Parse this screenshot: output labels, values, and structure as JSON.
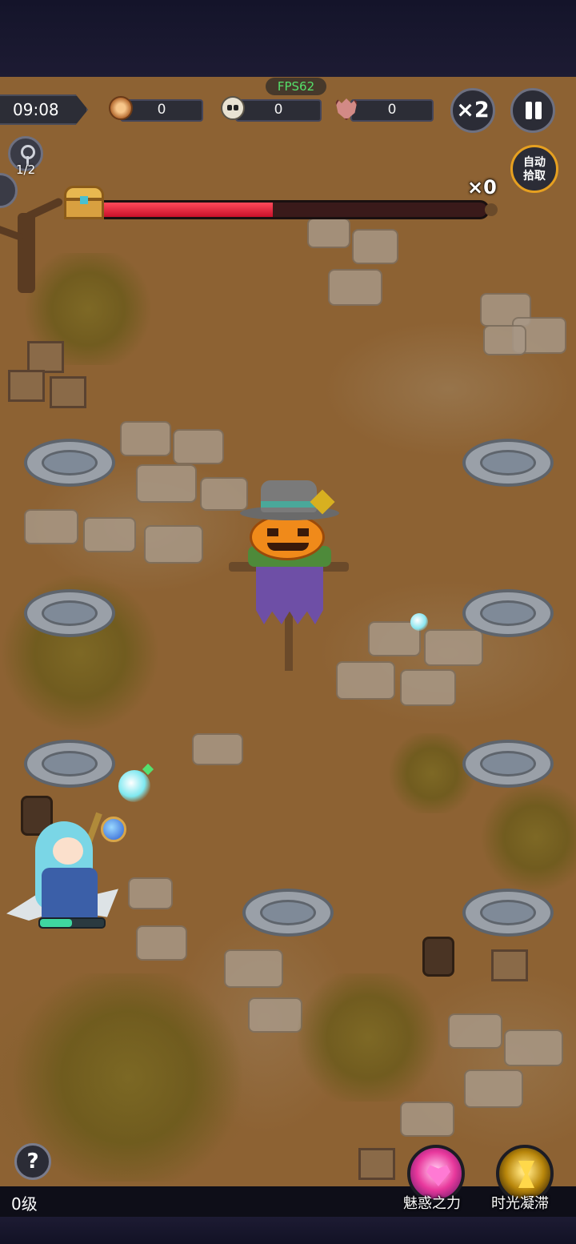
{
  "hud": {
    "timer": "09:08",
    "fps": "FPS62",
    "coins": "0",
    "kills": "0",
    "elites": "0",
    "speed": "×2",
    "auto_pickup_line1": "自动",
    "auto_pickup_line2": "拾取",
    "keys": "1/2",
    "chest_multiplier": "×0",
    "chest_progress_percent": 45
  },
  "player": {
    "hp_percent": 50
  },
  "bottom": {
    "level": "0级",
    "help": "?",
    "skills": [
      {
        "label": "魅惑之力",
        "icon": "heart-icon"
      },
      {
        "label": "时光凝滞",
        "icon": "hourglass-icon"
      }
    ]
  },
  "colors": {
    "ground": "#8d6233",
    "progress_fill": "#e0233c",
    "fps_text": "#55e06a",
    "auto_border": "#e6a020"
  }
}
